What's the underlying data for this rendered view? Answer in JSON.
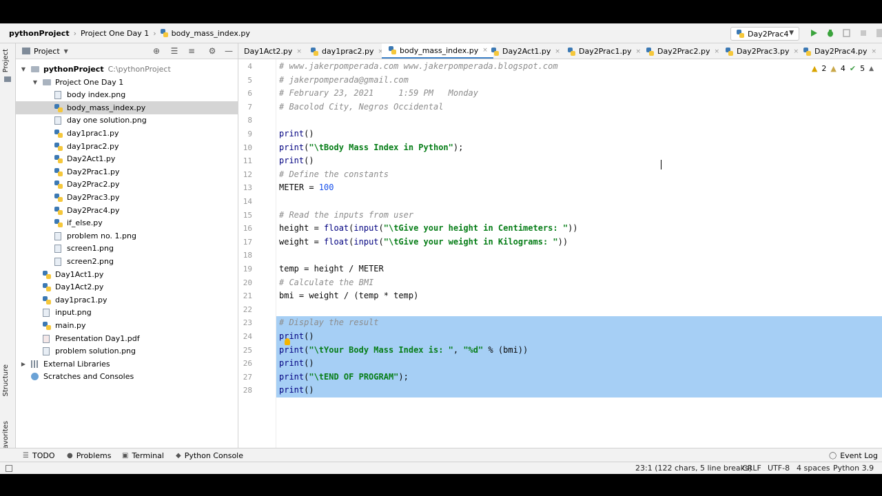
{
  "breadcrumb": {
    "project": "pythonProject",
    "folder": "Project One Day 1",
    "file": "body_mass_index.py"
  },
  "run_config": {
    "label": "Day2Prac4"
  },
  "left_stripe": {
    "project": "Project",
    "structure": "Structure",
    "favorites": "Favorites"
  },
  "project_panel": {
    "title": "Project",
    "root": {
      "name": "pythonProject",
      "path": "C:\\pythonProject"
    },
    "folder": "Project One Day 1",
    "folder_items": [
      "body index.png",
      "body_mass_index.py",
      "day one solution.png",
      "day1prac1.py",
      "day1prac2.py",
      "Day2Act1.py",
      "Day2Prac1.py",
      "Day2Prac2.py",
      "Day2Prac3.py",
      "Day2Prac4.py",
      "if_else.py",
      "problem no. 1.png",
      "screen1.png",
      "screen2.png"
    ],
    "root_items": [
      "Day1Act1.py",
      "Day1Act2.py",
      "day1prac1.py",
      "input.png",
      "main.py",
      "Presentation Day1.pdf",
      "problem solution.png"
    ],
    "external_libraries": "External Libraries",
    "scratches": "Scratches and Consoles"
  },
  "editor_tabs": [
    "Day1Act2.py",
    "day1prac2.py",
    "body_mass_index.py",
    "Day2Act1.py",
    "Day2Prac1.py",
    "Day2Prac2.py",
    "Day2Prac3.py",
    "Day2Prac4.py"
  ],
  "inspections": {
    "warnings_a": "2",
    "warnings_b": "4",
    "ok": "5"
  },
  "code_lines": [
    {
      "n": "4",
      "text": "# www.jakerpomperada.com www.jakerpomperada.blogspot.com"
    },
    {
      "n": "5",
      "text": "# jakerpomperada@gmail.com"
    },
    {
      "n": "6",
      "text": "# February 23, 2021     1:59 PM   Monday"
    },
    {
      "n": "7",
      "text": "# Bacolod City, Negros Occidental"
    },
    {
      "n": "8",
      "text": ""
    },
    {
      "n": "9",
      "text": "print()"
    },
    {
      "n": "10",
      "text": "print(\"\\tBody Mass Index in Python\");"
    },
    {
      "n": "11",
      "text": "print()"
    },
    {
      "n": "12",
      "text": "# Define the constants"
    },
    {
      "n": "13",
      "text": "METER = 100"
    },
    {
      "n": "14",
      "text": ""
    },
    {
      "n": "15",
      "text": "# Read the inputs from user"
    },
    {
      "n": "16",
      "text": "height = float(input(\"\\tGive your height in Centimeters: \"))"
    },
    {
      "n": "17",
      "text": "weight = float(input(\"\\tGive your weight in Kilograms: \"))"
    },
    {
      "n": "18",
      "text": ""
    },
    {
      "n": "19",
      "text": "temp = height / METER"
    },
    {
      "n": "20",
      "text": "# Calculate the BMI"
    },
    {
      "n": "21",
      "text": "bmi = weight / (temp * temp)"
    },
    {
      "n": "22",
      "text": ""
    },
    {
      "n": "23",
      "text": "# Display the result"
    },
    {
      "n": "24",
      "text": "print()"
    },
    {
      "n": "25",
      "text": "print(\"\\tYour Body Mass Index is: \", \"%d\" % (bmi))"
    },
    {
      "n": "26",
      "text": "print()"
    },
    {
      "n": "27",
      "text": "print(\"\\tEND OF PROGRAM\");"
    },
    {
      "n": "28",
      "text": "print()"
    }
  ],
  "bottom_tools": {
    "todo": "TODO",
    "problems": "Problems",
    "terminal": "Terminal",
    "python_console": "Python Console",
    "event_log": "Event Log"
  },
  "status": {
    "position": "23:1 (122 chars, 5 line breaks)",
    "line_sep": "CRLF",
    "encoding": "UTF-8",
    "indent": "4 spaces",
    "interpreter": "Python 3.9"
  },
  "colors": {
    "accent": "#4083c9",
    "selection": "#a6cff5",
    "run": "#3aa33c"
  }
}
